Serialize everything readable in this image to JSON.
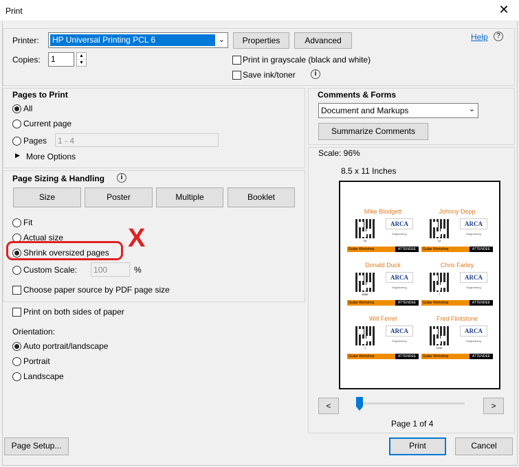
{
  "window": {
    "title": "Print",
    "close": "✕"
  },
  "printer": {
    "label": "Printer:",
    "value": "HP Universal Printing PCL 6",
    "properties": "Properties",
    "advanced": "Advanced",
    "help": "Help"
  },
  "copies": {
    "label": "Copies:",
    "value": "1"
  },
  "options": {
    "grayscale": "Print in grayscale (black and white)",
    "save_ink": "Save ink/toner"
  },
  "pages": {
    "title": "Pages to Print",
    "all": "All",
    "current": "Current page",
    "pages": "Pages",
    "range": "1 - 4",
    "more": "More Options"
  },
  "sizing": {
    "title": "Page Sizing & Handling",
    "size": "Size",
    "poster": "Poster",
    "multiple": "Multiple",
    "booklet": "Booklet",
    "fit": "Fit",
    "actual": "Actual size",
    "shrink": "Shrink oversized pages",
    "custom": "Custom Scale:",
    "custom_value": "100",
    "percent": "%",
    "paper_source": "Choose paper source by PDF page size",
    "annotation_mark": "X",
    "annotation_color": "#e02020"
  },
  "duplex": {
    "both_sides": "Print on both sides of paper"
  },
  "orientation": {
    "title": "Orientation:",
    "auto": "Auto portrait/landscape",
    "portrait": "Portrait",
    "landscape": "Landscape"
  },
  "comments": {
    "title": "Comments & Forms",
    "value": "Document and Markups",
    "summarize": "Summarize Comments"
  },
  "preview": {
    "scale": "Scale:  96%",
    "paper": "8.5 x 11 Inches",
    "page_info": "Page 1 of 4",
    "prev": "<",
    "next": ">",
    "cards": [
      {
        "name": "Mike Blodgett",
        "num": "10"
      },
      {
        "name": "Johnny Depp",
        "num": "14"
      },
      {
        "name": "Donald Duck",
        "num": "8386"
      },
      {
        "name": "Chris Farley",
        "num": "7"
      },
      {
        "name": "Will Ferrel",
        "num": "1"
      },
      {
        "name": "Fred Flintstone",
        "num": "1010"
      }
    ],
    "logo": "ARCA",
    "eng": "Engineering",
    "workshop": "Guitar Workshop",
    "attendee": "ATTENDEE"
  },
  "footer": {
    "page_setup": "Page Setup...",
    "print": "Print",
    "cancel": "Cancel"
  }
}
